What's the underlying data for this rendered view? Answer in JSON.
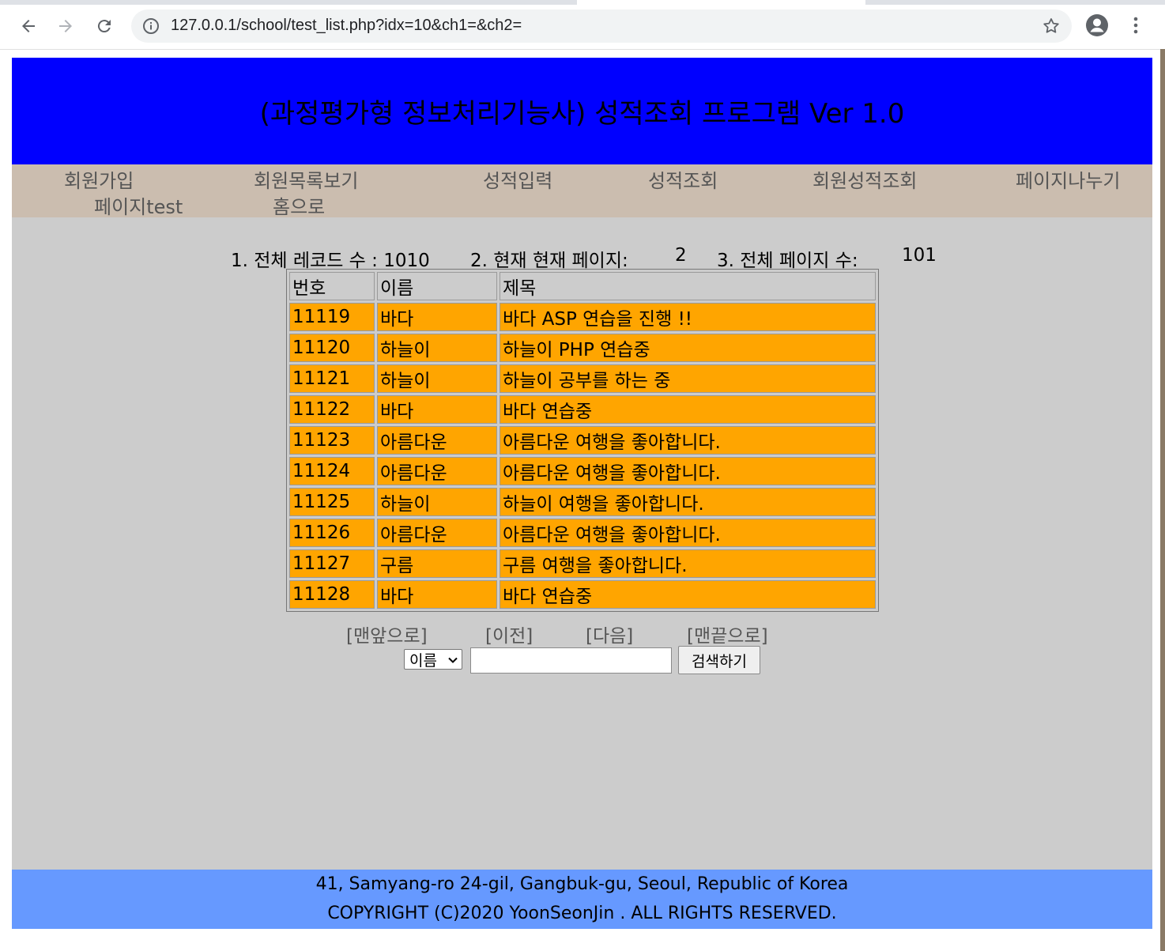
{
  "browser": {
    "url": "127.0.0.1/school/test_list.php?idx=10&ch1=&ch2="
  },
  "header": {
    "title": "(과정평가형 정보처리기능사) 성적조회 프로그램 Ver 1.0"
  },
  "nav": {
    "items": [
      "회원가입",
      "회원목록보기",
      "성적입력",
      "성적조회",
      "회원성적조회",
      "페이지나누기",
      "페이지test",
      "홈으로"
    ]
  },
  "stats": {
    "total_records": "1. 전체 레코드 수 : 1010",
    "current_page_label": "2. 현재 현재 페이지:",
    "current_page_value": "2",
    "total_pages_label": "3. 전체 페이지 수:",
    "total_pages_value": "101"
  },
  "table": {
    "headers": [
      "번호",
      "이름",
      "제목"
    ],
    "rows": [
      [
        "11119",
        "바다",
        "바다 ASP 연습을 진행 !!"
      ],
      [
        "11120",
        "하늘이",
        "하늘이 PHP 연습중"
      ],
      [
        "11121",
        "하늘이",
        "하늘이 공부를 하는 중"
      ],
      [
        "11122",
        "바다",
        "바다 연습중"
      ],
      [
        "11123",
        "아름다운",
        "아름다운 여행을 좋아합니다."
      ],
      [
        "11124",
        "아름다운",
        "아름다운 여행을 좋아합니다."
      ],
      [
        "11125",
        "하늘이",
        "하늘이 여행을 좋아합니다."
      ],
      [
        "11126",
        "아름다운",
        "아름다운 여행을 좋아합니다."
      ],
      [
        "11127",
        "구름",
        "구름 여행을 좋아합니다."
      ],
      [
        "11128",
        "바다",
        "바다 연습중"
      ]
    ]
  },
  "pager": {
    "first": "[맨앞으로]",
    "prev": "[이전]",
    "next": "[다음]",
    "last": "[맨끝으로]"
  },
  "search": {
    "selected": "이름",
    "input_value": "",
    "button_label": "검색하기"
  },
  "footer": {
    "address": "41, Samyang-ro 24-gil, Gangbuk-gu, Seoul, Republic of Korea",
    "copyright": "COPYRIGHT (C)2020 YoonSeonJin . ALL RIGHTS RESERVED."
  }
}
